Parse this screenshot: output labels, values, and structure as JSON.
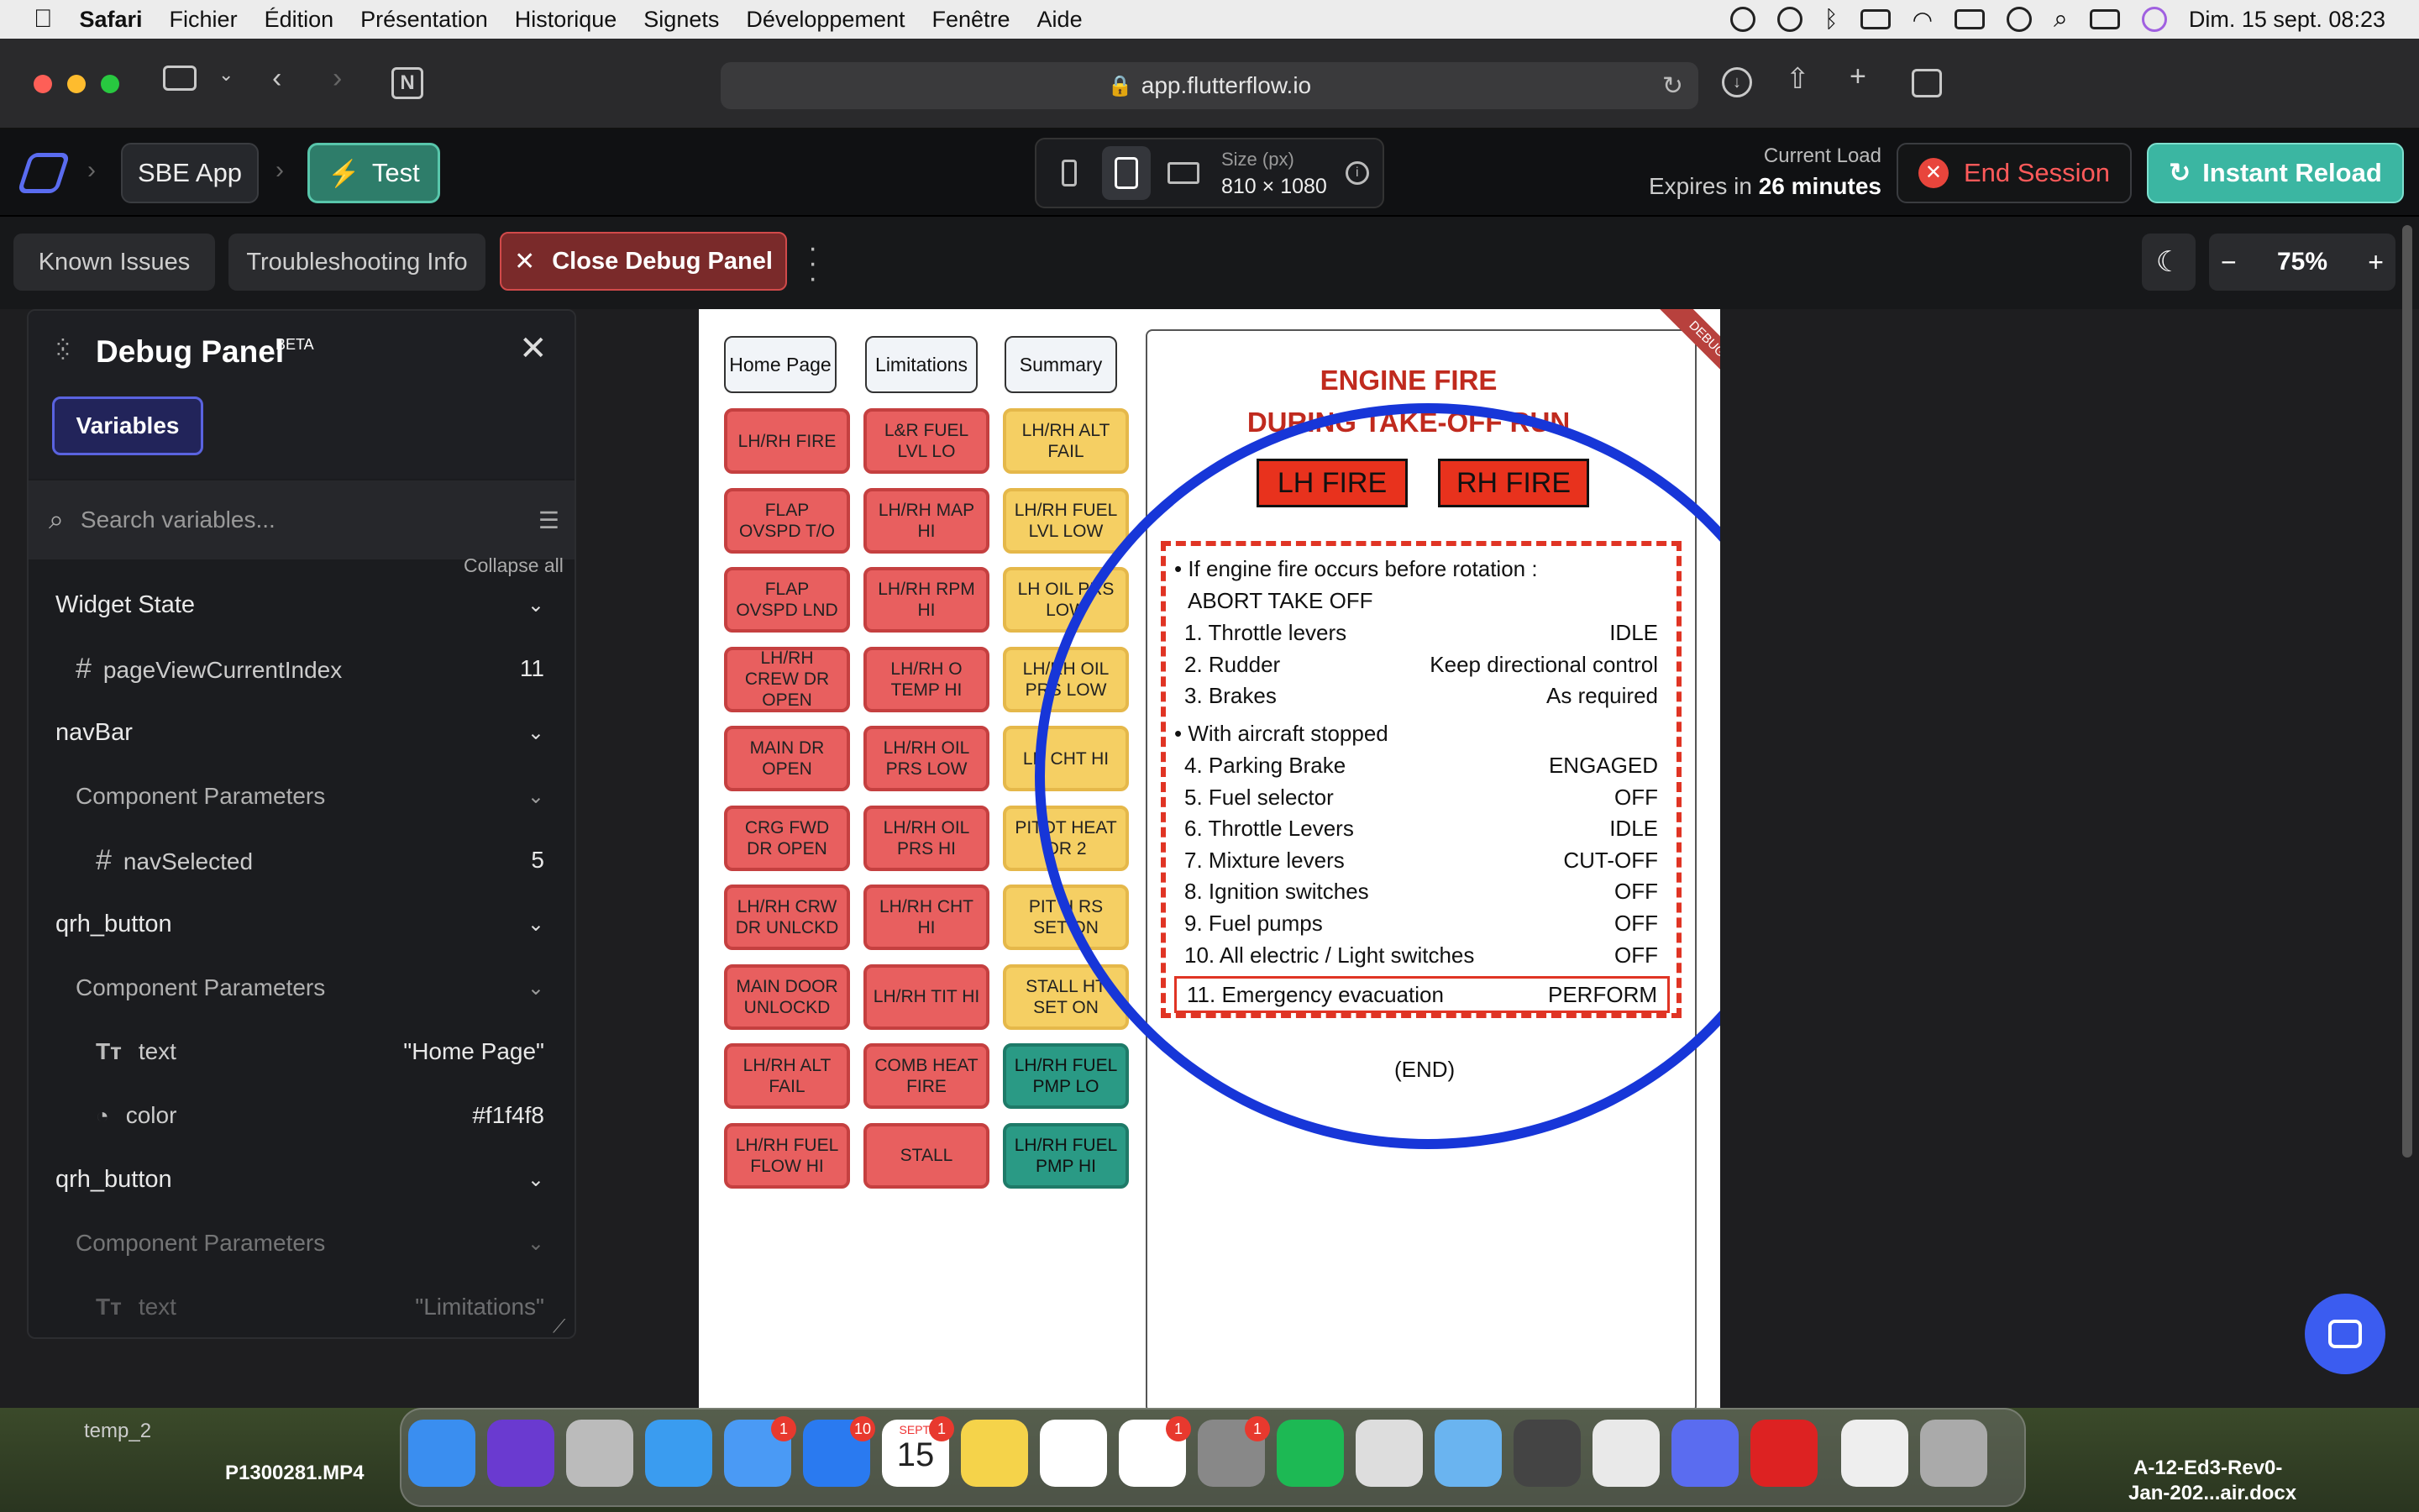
{
  "menubar": {
    "apple": "",
    "app": "Safari",
    "items": [
      "Fichier",
      "Édition",
      "Présentation",
      "Historique",
      "Signets",
      "Développement",
      "Fenêtre",
      "Aide"
    ],
    "clock": "Dim. 15 sept.  08:23"
  },
  "safari": {
    "url": "app.flutterflow.io"
  },
  "ff": {
    "project": "SBE App",
    "test": "Test",
    "size_label": "Size (px)",
    "size_value": "810 × 1080",
    "load_label": "Current Load",
    "expires_prefix": "Expires in",
    "expires_value": "26 minutes",
    "end_session": "End Session",
    "instant_reload": "Instant Reload"
  },
  "tabs": {
    "known_issues": "Known Issues",
    "troubleshooting": "Troubleshooting Info",
    "close_debug": "Close Debug Panel",
    "zoom": "75%"
  },
  "debug": {
    "title": "Debug Panel",
    "beta": "BETA",
    "variables_tab": "Variables",
    "search_placeholder": "Search variables...",
    "collapse_all": "Collapse all",
    "rows": [
      {
        "label": "Widget State",
        "kind": "section"
      },
      {
        "label": "pageViewCurrentIndex",
        "kind": "int",
        "value": "11"
      },
      {
        "label": "navBar",
        "kind": "section"
      },
      {
        "label": "Component Parameters",
        "kind": "sub"
      },
      {
        "label": "navSelected",
        "kind": "int",
        "value": "5"
      },
      {
        "label": "qrh_button",
        "kind": "section"
      },
      {
        "label": "Component Parameters",
        "kind": "sub"
      },
      {
        "label": "text",
        "kind": "text",
        "value": "\"Home Page\""
      },
      {
        "label": "color",
        "kind": "color",
        "value": "#f1f4f8"
      },
      {
        "label": "qrh_button",
        "kind": "section"
      },
      {
        "label": "Component Parameters",
        "kind": "sub"
      },
      {
        "label": "text",
        "kind": "text",
        "value": "\"Limitations\""
      }
    ]
  },
  "app": {
    "nav": [
      "Home Page",
      "Limitations",
      "Summary"
    ],
    "tiles": [
      [
        "LH/RH FIRE",
        "L&R FUEL LVL LO",
        "LH/RH ALT FAIL"
      ],
      [
        "FLAP OVSPD T/O",
        "LH/RH MAP HI",
        "LH/RH FUEL LVL LOW"
      ],
      [
        "FLAP OVSPD LND",
        "LH/RH RPM HI",
        "LH OIL PRS LOW"
      ],
      [
        "LH/RH CREW DR OPEN",
        "LH/RH O TEMP HI",
        "LH/RH OIL PRS LOW"
      ],
      [
        "MAIN DR OPEN",
        "LH/RH OIL PRS LOW",
        "LH CHT HI"
      ],
      [
        "CRG FWD DR OPEN",
        "LH/RH OIL PRS HI",
        "PITOT HEAT OR 2"
      ],
      [
        "LH/RH CRW DR UNLCKD",
        "LH/RH CHT HI",
        "PIT H RS SET ON"
      ],
      [
        "MAIN DOOR UNLOCKD",
        "LH/RH TIT HI",
        "STALL HT SET ON"
      ],
      [
        "LH/RH ALT FAIL",
        "COMB HEAT FIRE",
        "LH/RH FUEL PMP LO"
      ],
      [
        "LH/RH FUEL FLOW HI",
        "STALL",
        "LH/RH FUEL PMP HI"
      ]
    ],
    "tile_colors": [
      [
        "red",
        "red",
        "yel"
      ],
      [
        "red",
        "red",
        "yel"
      ],
      [
        "red",
        "red",
        "yel"
      ],
      [
        "red",
        "red",
        "yel"
      ],
      [
        "red",
        "red",
        "yel"
      ],
      [
        "red",
        "red",
        "yel"
      ],
      [
        "red",
        "red",
        "yel"
      ],
      [
        "red",
        "red",
        "yel"
      ],
      [
        "red",
        "red",
        "teal"
      ],
      [
        "red",
        "red",
        "teal"
      ]
    ],
    "title_line1": "ENGINE FIRE",
    "title_line2": "DURING TAKE-OFF RUN",
    "lh_fire": "LH FIRE",
    "rh_fire": "RH FIRE",
    "debug_ribbon": "DEBUG",
    "bullet1": "• If engine fire occurs before rotation :",
    "abort": "ABORT TAKE OFF",
    "steps1": [
      [
        "1. Throttle levers",
        "IDLE"
      ],
      [
        "2. Rudder",
        "Keep directional control"
      ],
      [
        "3. Brakes",
        "As required"
      ]
    ],
    "bullet2": "• With aircraft stopped",
    "steps2": [
      [
        "4. Parking Brake",
        "ENGAGED"
      ],
      [
        "5. Fuel selector",
        "OFF"
      ],
      [
        "6. Throttle Levers",
        "IDLE"
      ],
      [
        "7. Mixture levers",
        "CUT-OFF"
      ],
      [
        "8. Ignition switches",
        "OFF"
      ],
      [
        "9. Fuel pumps",
        "OFF"
      ],
      [
        "10. All electric / Light switches",
        "OFF"
      ]
    ],
    "evac_label": "11. Emergency evacuation",
    "evac_value": "PERFORM",
    "end": "(END)"
  },
  "desktop": {
    "label1": "temp_2",
    "label2": "P1300281.MP4",
    "label3a": "A-12-Ed3-Rev0-",
    "label3b": "Jan-202...air.docx",
    "cal_month": "SEPT.",
    "cal_day": "15"
  },
  "colors": {
    "accent_teal": "#3bb6a2",
    "danger": "#e03424",
    "circle": "#1736d8"
  }
}
